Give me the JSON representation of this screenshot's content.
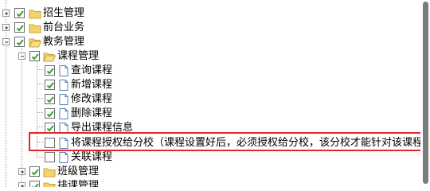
{
  "tree": {
    "nodes": [
      {
        "label": "招生管理",
        "checked": true,
        "expander": "plus",
        "icon": "folder-icon"
      },
      {
        "label": "前台业务",
        "checked": true,
        "expander": "plus",
        "icon": "folder-icon"
      },
      {
        "label": "教务管理",
        "checked": true,
        "expander": "minus",
        "icon": "folder-open-icon"
      },
      {
        "label": "课程管理",
        "checked": true,
        "expander": "minus",
        "icon": "folder-open-icon"
      },
      {
        "label": "查询课程",
        "checked": true,
        "expander": "none",
        "icon": "page-icon"
      },
      {
        "label": "新增课程",
        "checked": true,
        "expander": "none",
        "icon": "page-icon"
      },
      {
        "label": "修改课程",
        "checked": true,
        "expander": "none",
        "icon": "page-icon"
      },
      {
        "label": "删除课程",
        "checked": true,
        "expander": "none",
        "icon": "page-icon"
      },
      {
        "label": "导出课程信息",
        "checked": true,
        "expander": "none",
        "icon": "page-icon"
      },
      {
        "label": "将课程授权给分校（课程设置好后，必须授权给分校，该分校才能针对该课程进行",
        "checked": false,
        "expander": "none",
        "icon": "page-icon"
      },
      {
        "label": "关联课程",
        "checked": false,
        "expander": "none",
        "icon": "page-icon"
      },
      {
        "label": "班级管理",
        "checked": true,
        "expander": "plus",
        "icon": "folder-icon"
      },
      {
        "label": "排课管理",
        "checked": true,
        "expander": "plus",
        "icon": "folder-icon"
      }
    ]
  },
  "colors": {
    "highlight": "#e8242b",
    "checkmark": "#3a9a3a",
    "folder": "#f5d36b"
  }
}
